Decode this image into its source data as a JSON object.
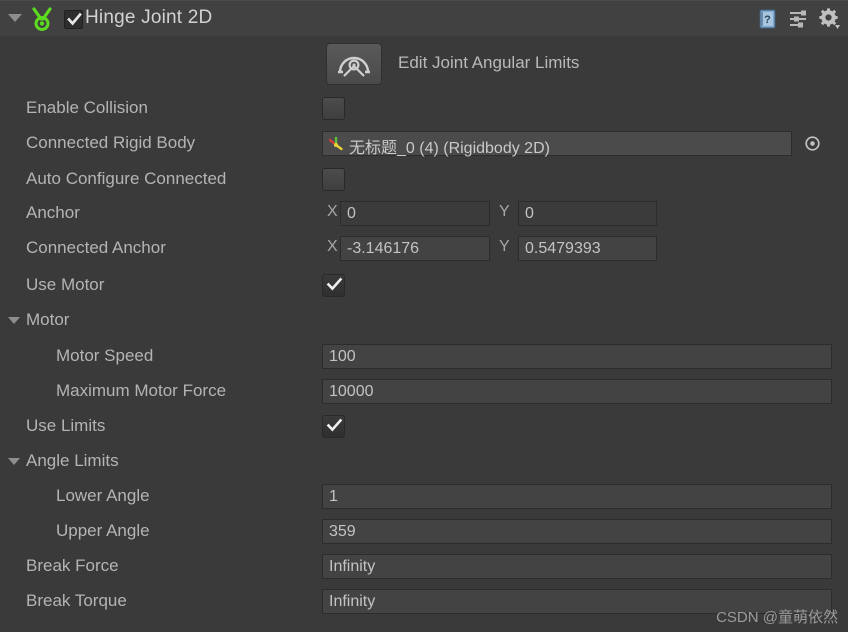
{
  "component": {
    "title": "Hinge Joint 2D",
    "enabled": true,
    "icon_name": "hinge-joint-2d-icon",
    "header_buttons": [
      {
        "name": "help-icon",
        "label": "?"
      },
      {
        "name": "preset-icon",
        "label": ""
      },
      {
        "name": "gear-icon",
        "label": ""
      }
    ]
  },
  "edit_tool": {
    "icon_name": "edit-joint-angular-limits-icon",
    "label": "Edit Joint Angular Limits"
  },
  "properties": {
    "enable_collision": {
      "label": "Enable Collision",
      "checked": false
    },
    "connected_rigid_body": {
      "label": "Connected Rigid Body",
      "value": "无标题_0 (4) (Rigidbody 2D)",
      "picker_icon": "object-picker-icon"
    },
    "auto_configure_connected": {
      "label": "Auto Configure Connected",
      "checked": false
    },
    "anchor": {
      "label": "Anchor",
      "x_label": "X",
      "x": "0",
      "y_label": "Y",
      "y": "0"
    },
    "connected_anchor": {
      "label": "Connected Anchor",
      "x_label": "X",
      "x": "-3.146176",
      "y_label": "Y",
      "y": "0.5479393"
    },
    "use_motor": {
      "label": "Use Motor",
      "checked": true
    },
    "motor_group": {
      "label": "Motor",
      "expanded": true
    },
    "motor_speed": {
      "label": "Motor Speed",
      "value": "100"
    },
    "maximum_motor_force": {
      "label": "Maximum Motor Force",
      "value": "10000"
    },
    "use_limits": {
      "label": "Use Limits",
      "checked": true
    },
    "angle_limits_group": {
      "label": "Angle Limits",
      "expanded": true
    },
    "lower_angle": {
      "label": "Lower Angle",
      "value": "1"
    },
    "upper_angle": {
      "label": "Upper Angle",
      "value": "359"
    },
    "break_force": {
      "label": "Break Force",
      "value": "Infinity"
    },
    "break_torque": {
      "label": "Break Torque",
      "value": "Infinity"
    }
  },
  "watermark": "CSDN @童萌依然",
  "colors": {
    "background": "#3a3a3a",
    "header_background": "#414141",
    "field_background": "#434343",
    "text": "#b4b4b4",
    "accent_green": "#5ddb1e"
  }
}
